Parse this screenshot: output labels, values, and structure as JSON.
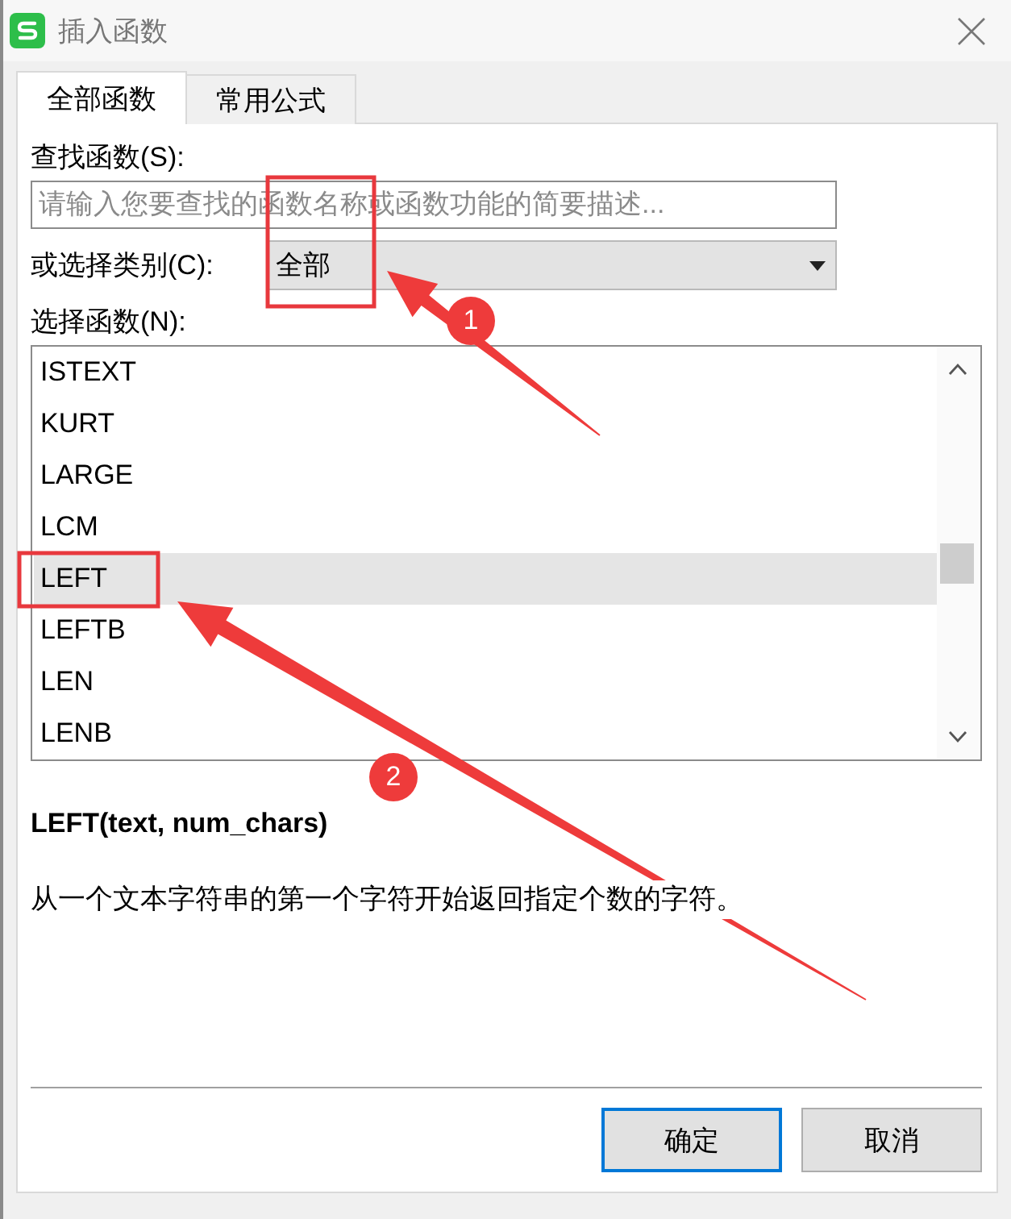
{
  "window": {
    "title": "插入函数"
  },
  "tabs": [
    {
      "label": "全部函数",
      "selected": true
    },
    {
      "label": "常用公式",
      "selected": false
    }
  ],
  "search": {
    "label": "查找函数(S):",
    "placeholder": "请输入您要查找的函数名称或函数功能的简要描述..."
  },
  "category": {
    "label": "或选择类别(C):",
    "value": "全部"
  },
  "function_list": {
    "label": "选择函数(N):",
    "items": [
      {
        "name": "ISTEXT",
        "selected": false
      },
      {
        "name": "KURT",
        "selected": false
      },
      {
        "name": "LARGE",
        "selected": false
      },
      {
        "name": "LCM",
        "selected": false
      },
      {
        "name": "LEFT",
        "selected": true
      },
      {
        "name": "LEFTB",
        "selected": false
      },
      {
        "name": "LEN",
        "selected": false
      },
      {
        "name": "LENB",
        "selected": false
      }
    ]
  },
  "signature": "LEFT(text, num_chars)",
  "description": "从一个文本字符串的第一个字符开始返回指定个数的字符。",
  "buttons": [
    {
      "label": "确定",
      "default": true
    },
    {
      "label": "取消",
      "default": false
    }
  ],
  "annotations": [
    {
      "label": "1"
    },
    {
      "label": "2"
    }
  ]
}
